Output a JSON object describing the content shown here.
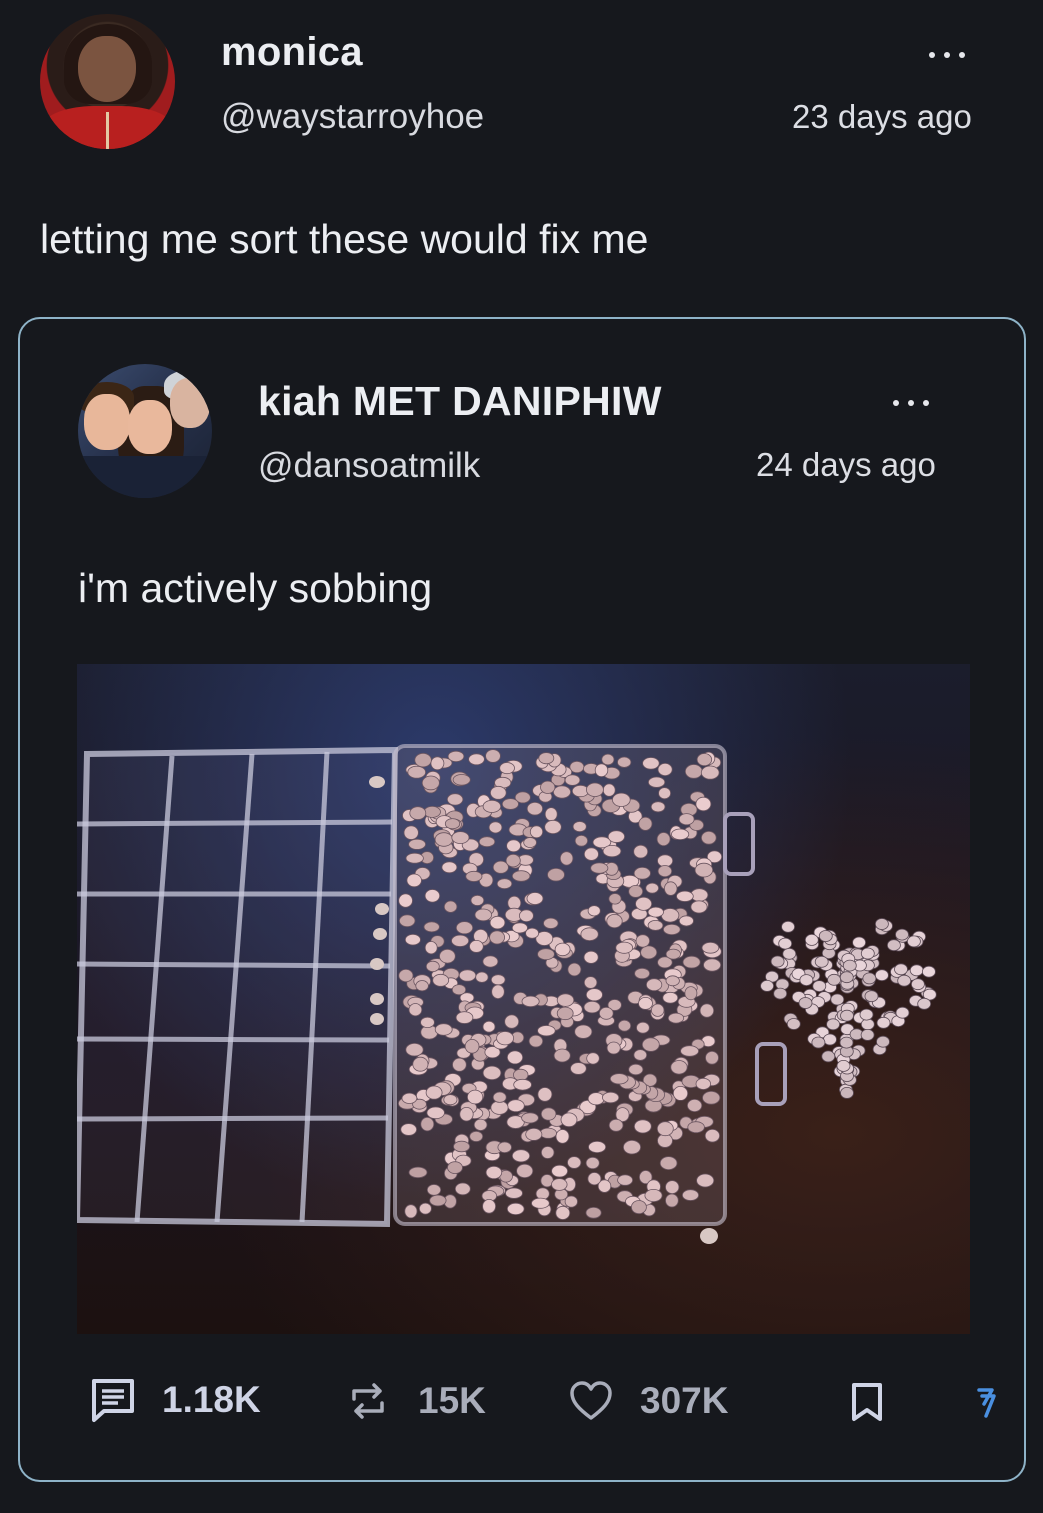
{
  "post": {
    "author_name": "monica",
    "handle": "@waystarroyhoe",
    "timestamp": "23 days ago",
    "text": "letting me sort these would fix me"
  },
  "quoted_post": {
    "author_name": "kiah MET DANIPHIW",
    "handle": "@dansoatmilk",
    "timestamp": "24 days ago",
    "text": "i'm actively sobbing",
    "actions": {
      "comments": "1.18K",
      "reposts": "15K",
      "likes": "307K"
    }
  },
  "icons": {
    "more": "more-horizontal-icon",
    "comment": "comment-icon",
    "repost": "repost-icon",
    "like": "heart-icon",
    "bookmark": "bookmark-icon",
    "share": "share-icon"
  },
  "colors": {
    "background": "#16181d",
    "card_border": "#8eb3c8",
    "action_text": "#cfd4e6",
    "share_accent": "#4a8fe0"
  }
}
